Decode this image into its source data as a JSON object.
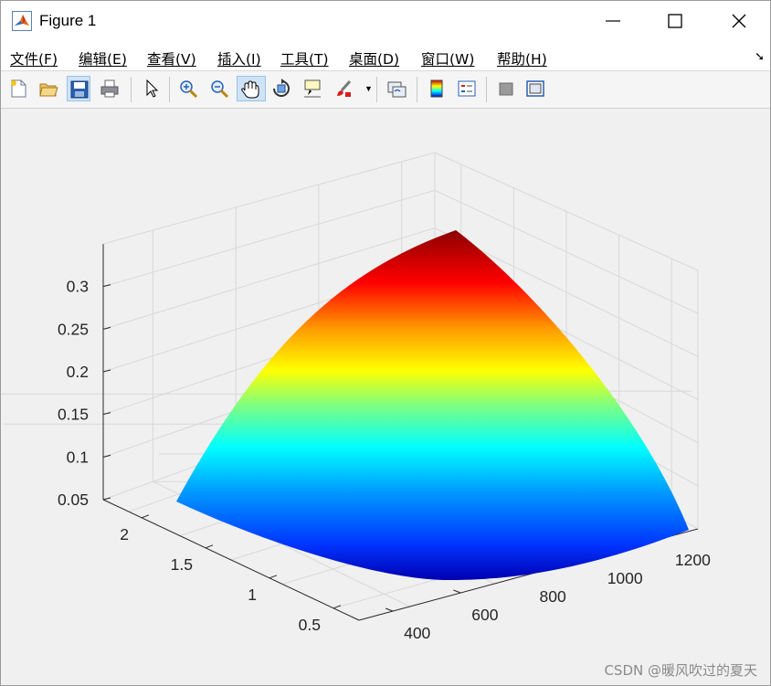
{
  "window": {
    "title": "Figure 1"
  },
  "menu": [
    "文件(F)",
    "编辑(E)",
    "查看(V)",
    "插入(I)",
    "工具(T)",
    "桌面(D)",
    "窗口(W)",
    "帮助(H)"
  ],
  "toolbar": {
    "icons": [
      "new-figure-icon",
      "open-file-icon",
      "save-icon",
      "print-icon",
      "pointer-icon",
      "zoom-in-icon",
      "zoom-out-icon",
      "pan-icon",
      "rotate-3d-icon",
      "data-cursor-icon",
      "brush-icon",
      "link-plot-icon",
      "colorbar-icon",
      "legend-icon",
      "hide-plot-tools-icon",
      "show-plot-tools-icon"
    ]
  },
  "chart_data": {
    "type": "surface",
    "colormap": "jet",
    "grid": true,
    "z_ticks": [
      "0.05",
      "0.1",
      "0.15",
      "0.2",
      "0.25",
      "0.3"
    ],
    "y_ticks": [
      "0.5",
      "1",
      "1.5",
      "2"
    ],
    "x_ticks": [
      "400",
      "600",
      "800",
      "1000",
      "1200"
    ],
    "zlim": [
      0.05,
      0.35
    ],
    "ylim": [
      0.3,
      2.3
    ],
    "xlim": [
      300,
      1300
    ]
  },
  "watermark": "CSDN @暖风吹过的夏天"
}
